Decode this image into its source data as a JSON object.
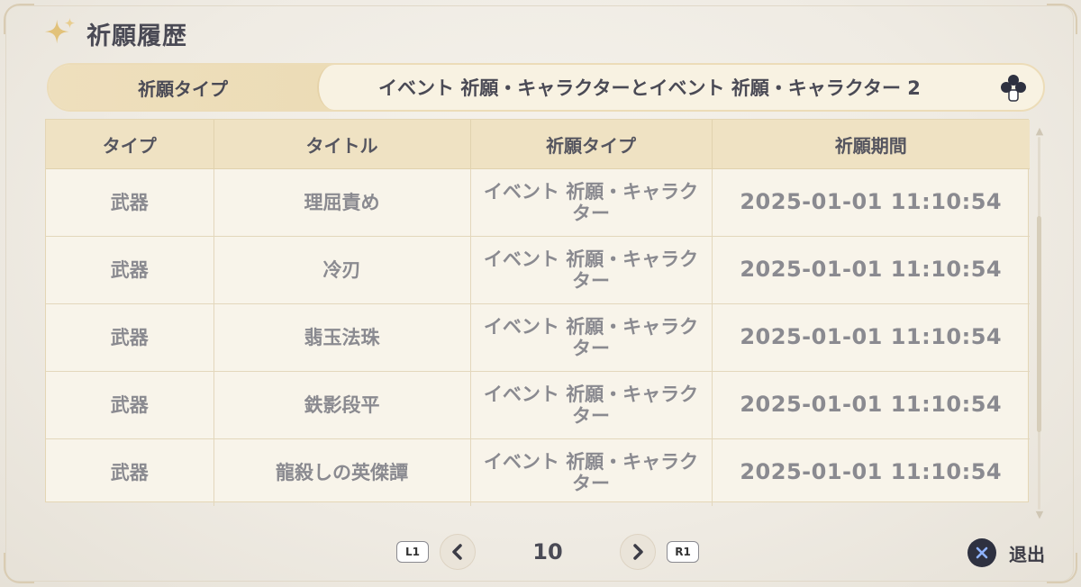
{
  "header": {
    "title": "祈願履歴",
    "icon": "sparkle-icon"
  },
  "filter": {
    "label": "祈願タイプ",
    "value": "イベント 祈願・キャラクターとイベント 祈願・キャラクター 2",
    "icon": "dpad-icon"
  },
  "table": {
    "columns": [
      "タイプ",
      "タイトル",
      "祈願タイプ",
      "祈願期間"
    ],
    "rows": [
      {
        "type": "武器",
        "title": "理屈責め",
        "gacha_type": "イベント 祈願・キャラクター",
        "time": "2025-01-01 11:10:54"
      },
      {
        "type": "武器",
        "title": "冷刃",
        "gacha_type": "イベント 祈願・キャラクター",
        "time": "2025-01-01 11:10:54"
      },
      {
        "type": "武器",
        "title": "翡玉法珠",
        "gacha_type": "イベント 祈願・キャラクター",
        "time": "2025-01-01 11:10:54"
      },
      {
        "type": "武器",
        "title": "鉄影段平",
        "gacha_type": "イベント 祈願・キャラクター",
        "time": "2025-01-01 11:10:54"
      },
      {
        "type": "武器",
        "title": "龍殺しの英傑譚",
        "gacha_type": "イベント 祈願・キャラクター",
        "time": "2025-01-01 11:10:54"
      }
    ]
  },
  "pager": {
    "prev_key": "L1",
    "next_key": "R1",
    "page": "10"
  },
  "footer": {
    "exit_label": "退出",
    "exit_icon": "cross-button-icon"
  },
  "colors": {
    "accent": "#efe2c3",
    "text_dark": "#4a4a55",
    "text_muted": "#8a8a90",
    "background": "#efebe4"
  }
}
